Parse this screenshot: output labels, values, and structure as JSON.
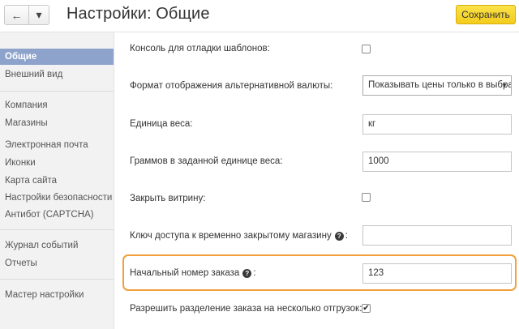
{
  "header": {
    "back_icon": "←",
    "menu_icon": "▾",
    "title": "Настройки: Общие",
    "save_label": "Сохранить"
  },
  "sidebar": {
    "items": [
      {
        "label": "Общие",
        "active": true
      },
      {
        "label": "Внешний вид"
      },
      {
        "label": "Компания"
      },
      {
        "label": "Магазины"
      },
      {
        "label": "Электронная почта"
      },
      {
        "label": "Иконки"
      },
      {
        "label": "Карта сайта"
      },
      {
        "label": "Настройки безопасности"
      },
      {
        "label": "Антибот (CAPTCHA)"
      },
      {
        "label": "Журнал событий"
      },
      {
        "label": "Отчеты"
      },
      {
        "label": "Мастер настройки"
      }
    ]
  },
  "form": {
    "debug_console": {
      "label": "Консоль для отладки шаблонов:",
      "checked": false
    },
    "alt_currency": {
      "label": "Формат отображения альтернативной валюты:",
      "value": "Показывать цены только в выбранной валюте"
    },
    "weight_unit": {
      "label": "Единица веса:",
      "value": "кг"
    },
    "grams_in_unit": {
      "label": "Граммов в заданной единице веса:",
      "value": "1000"
    },
    "close_storefront": {
      "label": "Закрыть витрину:",
      "checked": false
    },
    "access_key": {
      "label": "Ключ доступа к временно закрытому магазину",
      "suffix": ":",
      "value": ""
    },
    "start_order_number": {
      "label": "Начальный номер заказа",
      "suffix": ":",
      "value": "123"
    },
    "split_orders": {
      "label": "Разрешить разделение заказа на несколько отгрузок:",
      "checked": true
    }
  },
  "colors": {
    "accent_sidebar": "#8ea3cb",
    "save_button": "#f6d12a",
    "highlight": "#f0a03c"
  }
}
